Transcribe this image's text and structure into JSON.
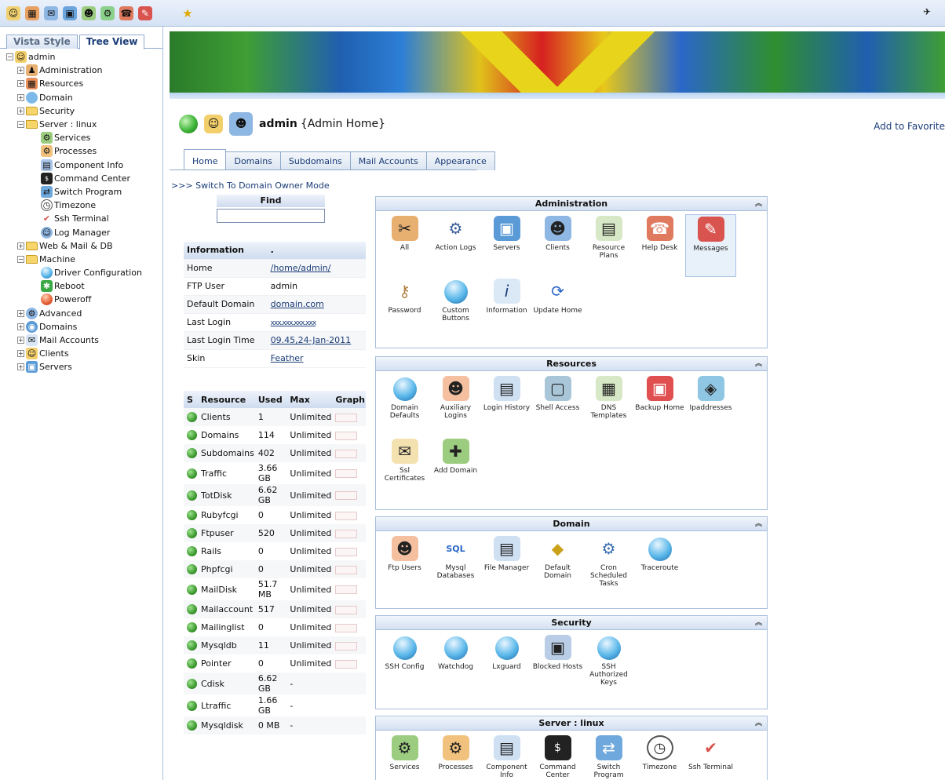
{
  "toolbar": {
    "icons": [
      "clients-icon",
      "resources-icon",
      "mail-icon",
      "servers-icon",
      "users-icon",
      "machine-icon",
      "helpdesk-icon",
      "messages-icon",
      "favorite-star-icon"
    ]
  },
  "left_panel": {
    "tabs": [
      "Vista Style",
      "Tree View"
    ],
    "tree": [
      {
        "label": "admin"
      },
      {
        "label": "Administration"
      },
      {
        "label": "Resources"
      },
      {
        "label": "Domain"
      },
      {
        "label": "Security"
      },
      {
        "label": "Server : linux"
      },
      {
        "label": "Services"
      },
      {
        "label": "Processes"
      },
      {
        "label": "Component Info"
      },
      {
        "label": "Command Center"
      },
      {
        "label": "Switch Program"
      },
      {
        "label": "Timezone"
      },
      {
        "label": "Ssh Terminal"
      },
      {
        "label": "Log Manager"
      },
      {
        "label": "Web & Mail & DB"
      },
      {
        "label": "Machine"
      },
      {
        "label": "Driver Configuration"
      },
      {
        "label": "Reboot"
      },
      {
        "label": "Poweroff"
      },
      {
        "label": "Advanced"
      },
      {
        "label": "Domains"
      },
      {
        "label": "Mail Accounts"
      },
      {
        "label": "Clients"
      },
      {
        "label": "Servers"
      }
    ]
  },
  "header": {
    "title": "admin",
    "subtitle": "{Admin Home}",
    "favorites": "Add to Favorite"
  },
  "tabs": [
    "Home",
    "Domains",
    "Subdomains",
    "Mail Accounts",
    "Appearance"
  ],
  "switch_link": ">>> Switch To Domain Owner Mode",
  "find": {
    "title": "Find",
    "value": ""
  },
  "info": {
    "header": [
      "Information",
      "."
    ],
    "rows": [
      {
        "label": "Home",
        "value": "/home/admin/"
      },
      {
        "label": "FTP User",
        "value": "admin"
      },
      {
        "label": "Default Domain",
        "value": "domain.com"
      },
      {
        "label": "Last Login",
        "value": "xxx.xxx.xxx.xxx"
      },
      {
        "label": "Last Login Time",
        "value": "09.45,24-Jan-2011"
      },
      {
        "label": "Skin",
        "value": "Feather"
      }
    ]
  },
  "resources_table": {
    "headers": [
      "S",
      "Resource",
      "Used",
      "Max",
      "Graph"
    ],
    "rows": [
      {
        "name": "Clients",
        "used": "1",
        "max": "Unlimited"
      },
      {
        "name": "Domains",
        "used": "114",
        "max": "Unlimited"
      },
      {
        "name": "Subdomains",
        "used": "402",
        "max": "Unlimited"
      },
      {
        "name": "Traffic",
        "used": "3.66 GB",
        "max": "Unlimited"
      },
      {
        "name": "TotDisk",
        "used": "6.62 GB",
        "max": "Unlimited"
      },
      {
        "name": "Rubyfcgi",
        "used": "0",
        "max": "Unlimited"
      },
      {
        "name": "Ftpuser",
        "used": "520",
        "max": "Unlimited"
      },
      {
        "name": "Rails",
        "used": "0",
        "max": "Unlimited"
      },
      {
        "name": "Phpfcgi",
        "used": "0",
        "max": "Unlimited"
      },
      {
        "name": "MailDisk",
        "used": "51.7 MB",
        "max": "Unlimited"
      },
      {
        "name": "Mailaccount",
        "used": "517",
        "max": "Unlimited"
      },
      {
        "name": "Mailinglist",
        "used": "0",
        "max": "Unlimited"
      },
      {
        "name": "Mysqldb",
        "used": "11",
        "max": "Unlimited"
      },
      {
        "name": "Pointer",
        "used": "0",
        "max": "Unlimited"
      },
      {
        "name": "Cdisk",
        "used": "6.62 GB",
        "max": "-"
      },
      {
        "name": "Ltraffic",
        "used": "1.66 GB",
        "max": "-"
      },
      {
        "name": "Mysqldisk",
        "used": "0 MB",
        "max": "-"
      }
    ]
  },
  "sections": {
    "administration": {
      "title": "Administration",
      "items": [
        "All",
        "Action Logs",
        "Servers",
        "Clients",
        "Resource Plans",
        "Help Desk",
        "Messages",
        "Password",
        "Custom Buttons",
        "Information",
        "Update Home"
      ]
    },
    "resources": {
      "title": "Resources",
      "items": [
        "Domain Defaults",
        "Auxiliary Logins",
        "Login History",
        "Shell Access",
        "DNS Templates",
        "Backup Home",
        "Ipaddresses",
        "Ssl Certificates",
        "Add Domain"
      ]
    },
    "domain": {
      "title": "Domain",
      "items": [
        "Ftp Users",
        "Mysql Databases",
        "File Manager",
        "Default Domain",
        "Cron Scheduled Tasks",
        "Traceroute"
      ]
    },
    "security": {
      "title": "Security",
      "items": [
        "SSH Config",
        "Watchdog",
        "Lxguard",
        "Blocked Hosts",
        "SSH Authorized Keys"
      ]
    },
    "server": {
      "title": "Server : linux",
      "items": [
        "Services",
        "Processes",
        "Component Info",
        "Command Center",
        "Switch Program",
        "Timezone",
        "Ssh Terminal"
      ]
    }
  },
  "collapse_glyph": "»"
}
